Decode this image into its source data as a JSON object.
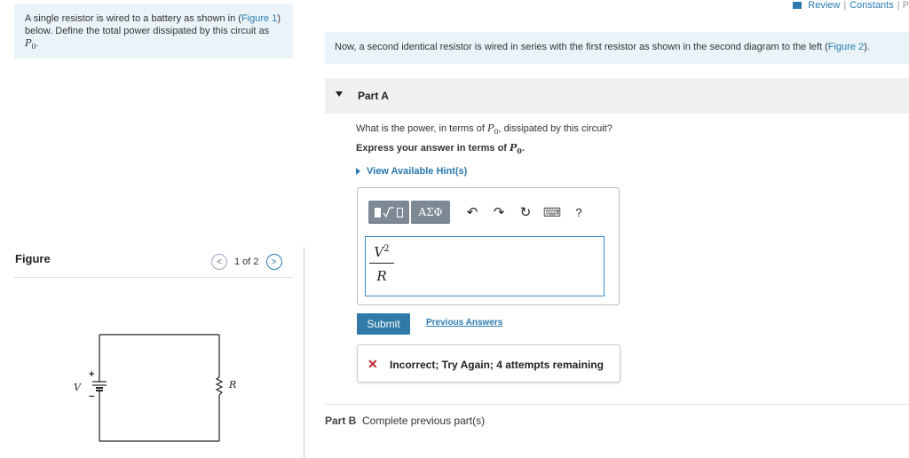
{
  "topbar": {
    "review": "Review",
    "separator": "|",
    "constants": "Constants",
    "trailing": "| P"
  },
  "intro": {
    "text_1": "A single resistor is wired to a battery as shown in (",
    "figure_link": "Figure 1",
    "text_2": ") below. Define the total power dissipated by this circuit as ",
    "symbol": "P",
    "symbol_sub": "0",
    "text_end": "."
  },
  "figure_panel": {
    "title": "Figure",
    "pager": {
      "current": "1 of 2",
      "prev": "<",
      "next": ">"
    },
    "circuit": {
      "battery_label": "V",
      "resistor_label": "R",
      "plus": "+",
      "minus": "−"
    }
  },
  "statement": {
    "text": "Now, a second identical resistor is wired in series with the first resistor as shown in the second diagram to the left (",
    "figure_link": "Figure 2",
    "text_end": ")."
  },
  "part_a": {
    "label": "Part A",
    "question_1": "What is the power, in terms of ",
    "question_symbol": "P",
    "question_sub": "0",
    "question_2": ", dissipated by this circuit?",
    "express_1": "Express your answer in terms of ",
    "express_symbol": "P",
    "express_sub": "0",
    "express_2": ".",
    "hints_label": "View Available Hint(s)",
    "toolbar": {
      "greek": "ΑΣΦ",
      "undo": "↶",
      "redo": "↷",
      "reset": "↻",
      "keyboard": "⌨",
      "help": "?"
    },
    "answer": {
      "numerator": "V",
      "numerator_exp": "2",
      "denominator": "R"
    },
    "submit_label": "Submit",
    "previous_answers_label": "Previous Answers",
    "feedback": {
      "icon": "✕",
      "text": "Incorrect; Try Again; 4 attempts remaining"
    }
  },
  "part_b": {
    "label": "Part B",
    "text": "Complete previous part(s)"
  }
}
